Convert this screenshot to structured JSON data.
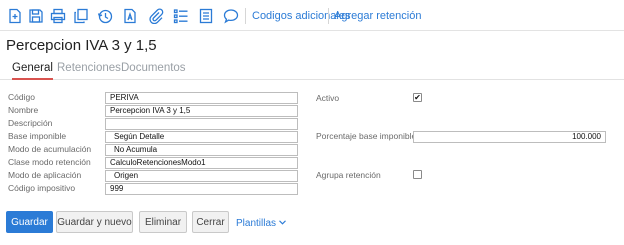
{
  "toolbar": {
    "icons": [
      "new-document-icon",
      "save-icon",
      "print-icon",
      "copy-icon",
      "history-icon",
      "text-document-icon",
      "attachment-icon",
      "list-icon",
      "document-icon",
      "comment-icon"
    ],
    "links": [
      "Codigos adicionales",
      "Agregar retención"
    ]
  },
  "page_title": "Percepcion IVA 3 y 1,5",
  "tabs": [
    "General",
    "Retenciones",
    "Documentos"
  ],
  "form": {
    "codigo": {
      "label": "Código",
      "value": "PERIVA"
    },
    "nombre": {
      "label": "Nombre",
      "value": "Percepcion IVA 3 y 1,5"
    },
    "descripcion": {
      "label": "Descripción",
      "value": ""
    },
    "base_imponible": {
      "label": "Base imponible",
      "value": "Según Detalle"
    },
    "modo_acumulacion": {
      "label": "Modo de acumulación",
      "value": "No Acumula"
    },
    "clase_modo_retencion": {
      "label": "Clase modo retención",
      "value": "CalculoRetencionesModo1"
    },
    "modo_aplicacion": {
      "label": "Modo de aplicación",
      "value": "Origen"
    },
    "codigo_impositivo": {
      "label": "Código impositivo",
      "value": "999"
    },
    "activo": {
      "label": "Activo",
      "checked": true,
      "mark": "✔"
    },
    "porcentaje_base": {
      "label": "Porcentaje base imponible",
      "value": "100.000"
    },
    "agrupa_retencion": {
      "label": "Agrupa retención",
      "checked": false,
      "mark": ""
    }
  },
  "buttons": {
    "guardar": "Guardar",
    "guardar_nuevo": "Guardar y nuevo",
    "eliminar": "Eliminar",
    "cerrar": "Cerrar",
    "plantillas": "Plantillas"
  },
  "colors": {
    "accent": "#2b7bd6",
    "tab_active": "#d9534f"
  }
}
